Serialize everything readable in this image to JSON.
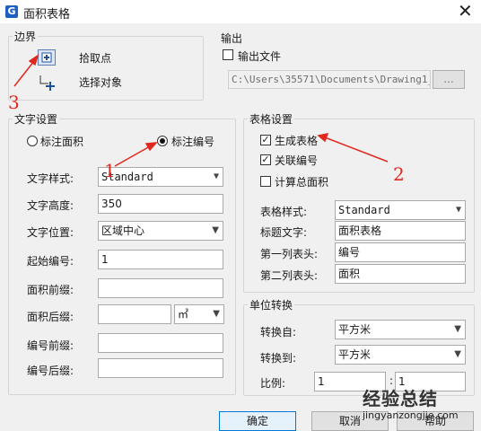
{
  "window": {
    "title": "面积表格",
    "app_icon": "G",
    "close_glyph": "✕"
  },
  "boundary": {
    "title": "边界",
    "pick_point_label": "拾取点",
    "select_objects_label": "选择对象"
  },
  "output": {
    "title": "输出",
    "output_file_label": "输出文件",
    "output_file_checked": false,
    "path_value": "C:\\Users\\35571\\Documents\\Drawing1_",
    "browse_label": "..."
  },
  "text_settings": {
    "title": "文字设置",
    "radio_area_label": "标注面积",
    "radio_number_label": "标注编号",
    "selected": "标注编号",
    "style_label": "文字样式:",
    "style_value": "Standard",
    "height_label": "文字高度:",
    "height_value": "350",
    "position_label": "文字位置:",
    "position_value": "区域中心",
    "start_number_label": "起始编号:",
    "start_number_value": "1",
    "area_prefix_label": "面积前缀:",
    "area_prefix_value": "",
    "area_suffix_label": "面积后缀:",
    "area_suffix_value": "",
    "area_unit_value": "㎡",
    "number_prefix_label": "编号前缀:",
    "number_prefix_value": "",
    "number_suffix_label": "编号后缀:",
    "number_suffix_value": ""
  },
  "table_settings": {
    "title": "表格设置",
    "generate_table_label": "生成表格",
    "generate_table_checked": true,
    "link_number_label": "关联编号",
    "link_number_checked": true,
    "calc_total_label": "计算总面积",
    "calc_total_checked": false,
    "table_style_label": "表格样式:",
    "table_style_value": "Standard",
    "title_text_label": "标题文字:",
    "title_text_value": "面积表格",
    "col1_header_label": "第一列表头:",
    "col1_header_value": "编号",
    "col2_header_label": "第二列表头:",
    "col2_header_value": "面积"
  },
  "unit_conversion": {
    "title": "单位转换",
    "from_label": "转换自:",
    "from_value": "平方米",
    "to_label": "转换到:",
    "to_value": "平方米",
    "ratio_label": "比例:",
    "ratio_left": "1",
    "ratio_sep": ":",
    "ratio_right": "1"
  },
  "buttons": {
    "ok": "确定",
    "cancel": "取消",
    "help": "帮助"
  },
  "annotations": {
    "n1": "1",
    "n2": "2",
    "n3": "3",
    "color": "#e2281e"
  },
  "watermark": {
    "main": "经验总结",
    "url": "jingyanzongjie.com"
  }
}
